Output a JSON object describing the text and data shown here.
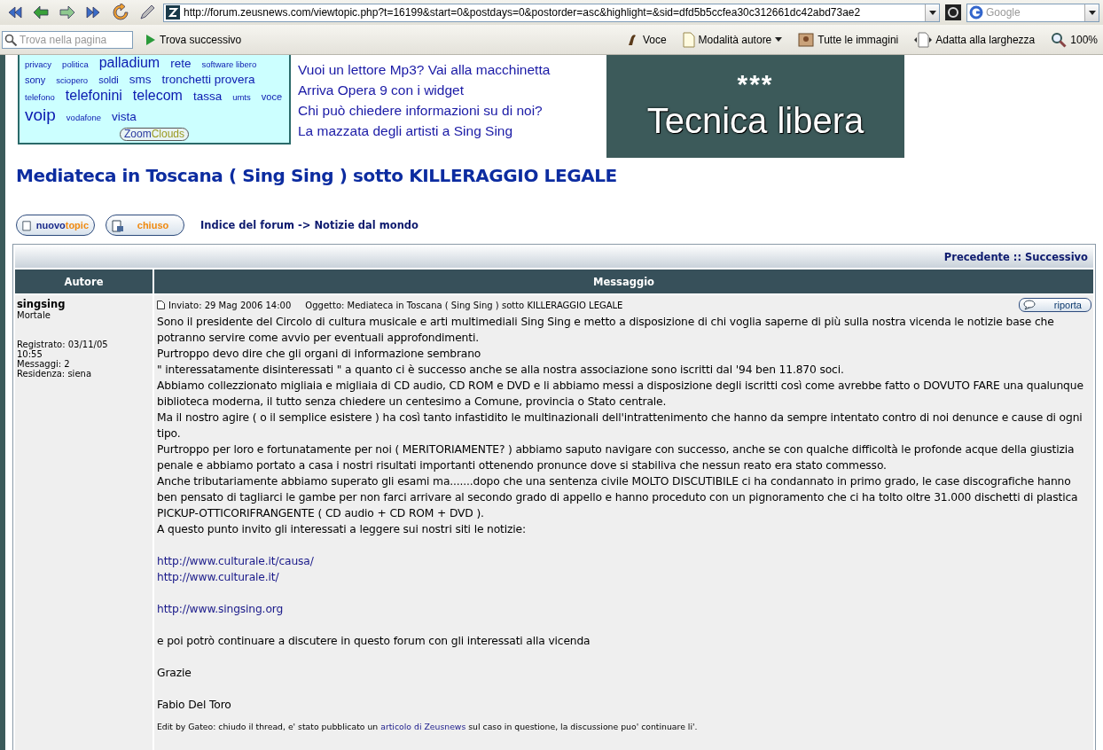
{
  "browser": {
    "url": "http://forum.zeusnews.com/viewtopic.php?t=16199&start=0&postdays=0&postorder=asc&highlight=&sid=dfd5b5ccfea30c312661dc42abd73ae2",
    "search_placeholder": "Google",
    "find_placeholder": "Trova nella pagina",
    "find_next": "Trova successivo",
    "tools": [
      {
        "kind": "voice",
        "label": "Voce"
      },
      {
        "kind": "author",
        "label": "Modalità autore"
      },
      {
        "kind": "images",
        "label": "Tutte le immagini"
      },
      {
        "kind": "fit",
        "label": "Adatta alla larghezza"
      },
      {
        "kind": "zoom",
        "label": "100%"
      }
    ]
  },
  "tag_cloud": {
    "tags": [
      {
        "label": "privacy",
        "kind": "xs"
      },
      {
        "label": "politica",
        "kind": "xs"
      },
      {
        "label": "palladium",
        "kind": "l"
      },
      {
        "label": "rete",
        "kind": "m"
      },
      {
        "label": "software libero",
        "kind": "xs"
      },
      {
        "label": "sony",
        "kind": "s"
      },
      {
        "label": "sciopero",
        "kind": "xs"
      },
      {
        "label": "soldi",
        "kind": "s"
      },
      {
        "label": "sms",
        "kind": "m"
      },
      {
        "label": "tronchetti provera",
        "kind": "m"
      },
      {
        "label": "telefono",
        "kind": "xs"
      },
      {
        "label": "telefonini",
        "kind": "l"
      },
      {
        "label": "telecom",
        "kind": "l"
      },
      {
        "label": "tassa",
        "kind": "m"
      },
      {
        "label": "umts",
        "kind": "xs"
      },
      {
        "label": "voce",
        "kind": "s"
      },
      {
        "label": "voip",
        "kind": "xl"
      },
      {
        "label": "vodafone",
        "kind": "xs"
      },
      {
        "label": "vista",
        "kind": "m"
      }
    ],
    "logo": [
      "Zoom",
      "Clouds"
    ]
  },
  "news": [
    "Vuoi un lettore Mp3? Vai alla macchinetta",
    "Arriva Opera 9 con i widget",
    "Chi può chiedere informazioni su di noi?",
    "La mazzata degli artisti a Sing Sing"
  ],
  "banner": {
    "stars": "***",
    "title": "Tecnica libera"
  },
  "topic_title": "Mediateca in Toscana ( Sing Sing ) sotto KILLERAGGIO LEGALE",
  "buttons": [
    {
      "kind": "new",
      "parts": [
        "nuovo",
        "topic"
      ]
    },
    {
      "kind": "locked",
      "parts": [
        "chiuso"
      ]
    }
  ],
  "breadcrumb": {
    "forum": "Indice del forum",
    "separator": "->",
    "section": "Notizie dal mondo"
  },
  "topic_nav": {
    "previous": "Precedente",
    "separator": "::",
    "next": "Successivo"
  },
  "columns": [
    "Autore",
    "Messaggio"
  ],
  "post": {
    "author": "singsing",
    "rank": "Mortale",
    "details": [
      "Registrato: 03/11/05",
      "10:55",
      "Messaggi: 2",
      "Residenza: siena"
    ],
    "posted": "Inviato: 29 Mag 2006 14:00",
    "subject": "Oggetto: Mediateca in Toscana ( Sing Sing ) sotto KILLERAGGIO LEGALE",
    "report": "riporta",
    "body": [
      {
        "kind": "text",
        "lines": [
          "Sono il presidente del Circolo di cultura musicale e arti multimediali Sing Sing e metto a disposizione di chi voglia saperne di più sulla nostra vicenda le notizie base che potranno servire come avvio per eventuali approfondimenti.",
          "Purtroppo devo dire che gli organi di informazione sembrano",
          "\" interessatamente disinteressati \" a quanto ci è successo anche se alla nostra associazione sono iscritti dal '94 ben 11.870 soci.",
          "Abbiamo collezzionato migliaia e migliaia di CD audio, CD ROM e DVD e li abbiamo messi a disposizione degli iscritti così come avrebbe fatto o DOVUTO FARE una qualunque biblioteca moderna, il tutto senza chiedere un centesimo a Comune, provincia o Stato centrale.",
          "Ma il nostro agire ( o il semplice esistere ) ha così tanto infastidito le multinazionali dell'intrattenimento che hanno da sempre intentato contro di noi denunce e cause di ogni tipo.",
          "Purtroppo per loro e fortunatamente per noi ( MERITORIAMENTE? ) abbiamo saputo navigare con successo, anche se con qualche difficoltà le profonde acque della giustizia penale e abbiamo portato a casa i nostri risultati importanti ottenendo pronunce dove si stabiliva che nessun reato era stato commesso.",
          "Anche tributariamente abbiamo superato gli esami ma.......dopo che una sentenza civile MOLTO DISCUTIBILE ci ha condannato in primo grado, le case discografiche hanno ben pensato di tagliarci le gambe per non farci arrivare al secondo grado di appello e hanno proceduto con un pignoramento che ci ha tolto oltre 31.000 dischetti di plastica PICKUP-OTTICORIFRANGENTE ( CD audio + CD ROM + DVD ).",
          "A questo punto invito gli interessati a leggere sui nostri siti le notizie:"
        ]
      },
      {
        "kind": "links",
        "lines": [
          "http://www.culturale.it/causa/",
          "http://www.culturale.it/"
        ]
      },
      {
        "kind": "links",
        "lines": [
          "http://www.singsing.org"
        ]
      },
      {
        "kind": "text",
        "lines": [
          "e poi potrò continuare a discutere in questo forum con gli interessati alla vicenda"
        ]
      },
      {
        "kind": "text",
        "lines": [
          "Grazie"
        ]
      },
      {
        "kind": "text",
        "lines": [
          "Fabio Del Toro"
        ]
      }
    ],
    "note": {
      "before": "Edit by Gateo: chiudo il thread, e' stato pubblicato un ",
      "link": "articolo di Zeusnews",
      "after": " sul caso in questione, la discussione puo' continuare li'."
    }
  }
}
